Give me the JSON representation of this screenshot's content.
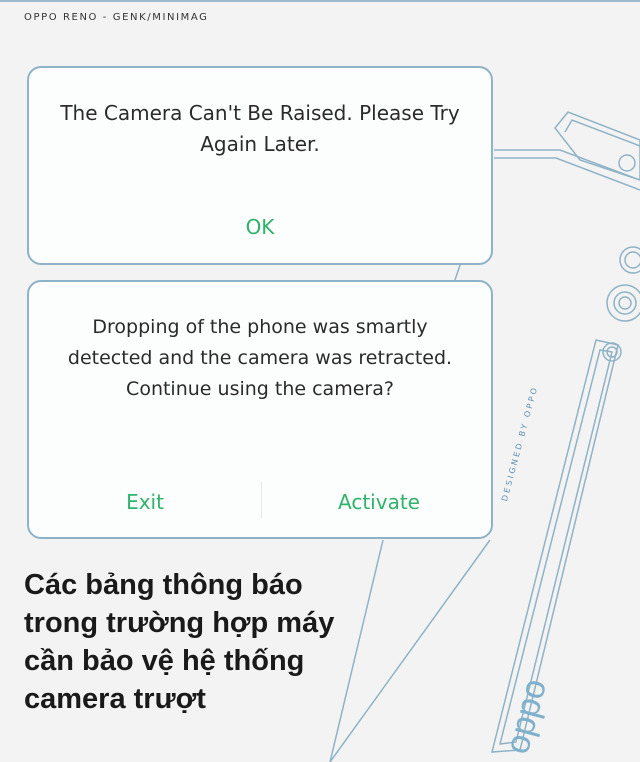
{
  "header": {
    "source_label": "OPPO RENO - GENK/MINIMAG"
  },
  "dialog_camera_error": {
    "message": "The Camera Can't Be Raised. Please Try Again Later.",
    "ok_label": "OK"
  },
  "dialog_drop_detected": {
    "message": "Dropping of the phone was smartly detected and the camera was retracted. Continue using the camera?",
    "exit_label": "Exit",
    "activate_label": "Activate"
  },
  "caption": {
    "text": "Các bảng thông báo trong trường hợp máy cần bảo vệ hệ thống camera trượt"
  },
  "illustration": {
    "designed_by_text": "DESIGNED BY OPPO",
    "brand_text": "oppo",
    "line_color": "#8fb3c6"
  },
  "colors": {
    "accent": "#2fb36b",
    "background": "#f3f3f3"
  }
}
